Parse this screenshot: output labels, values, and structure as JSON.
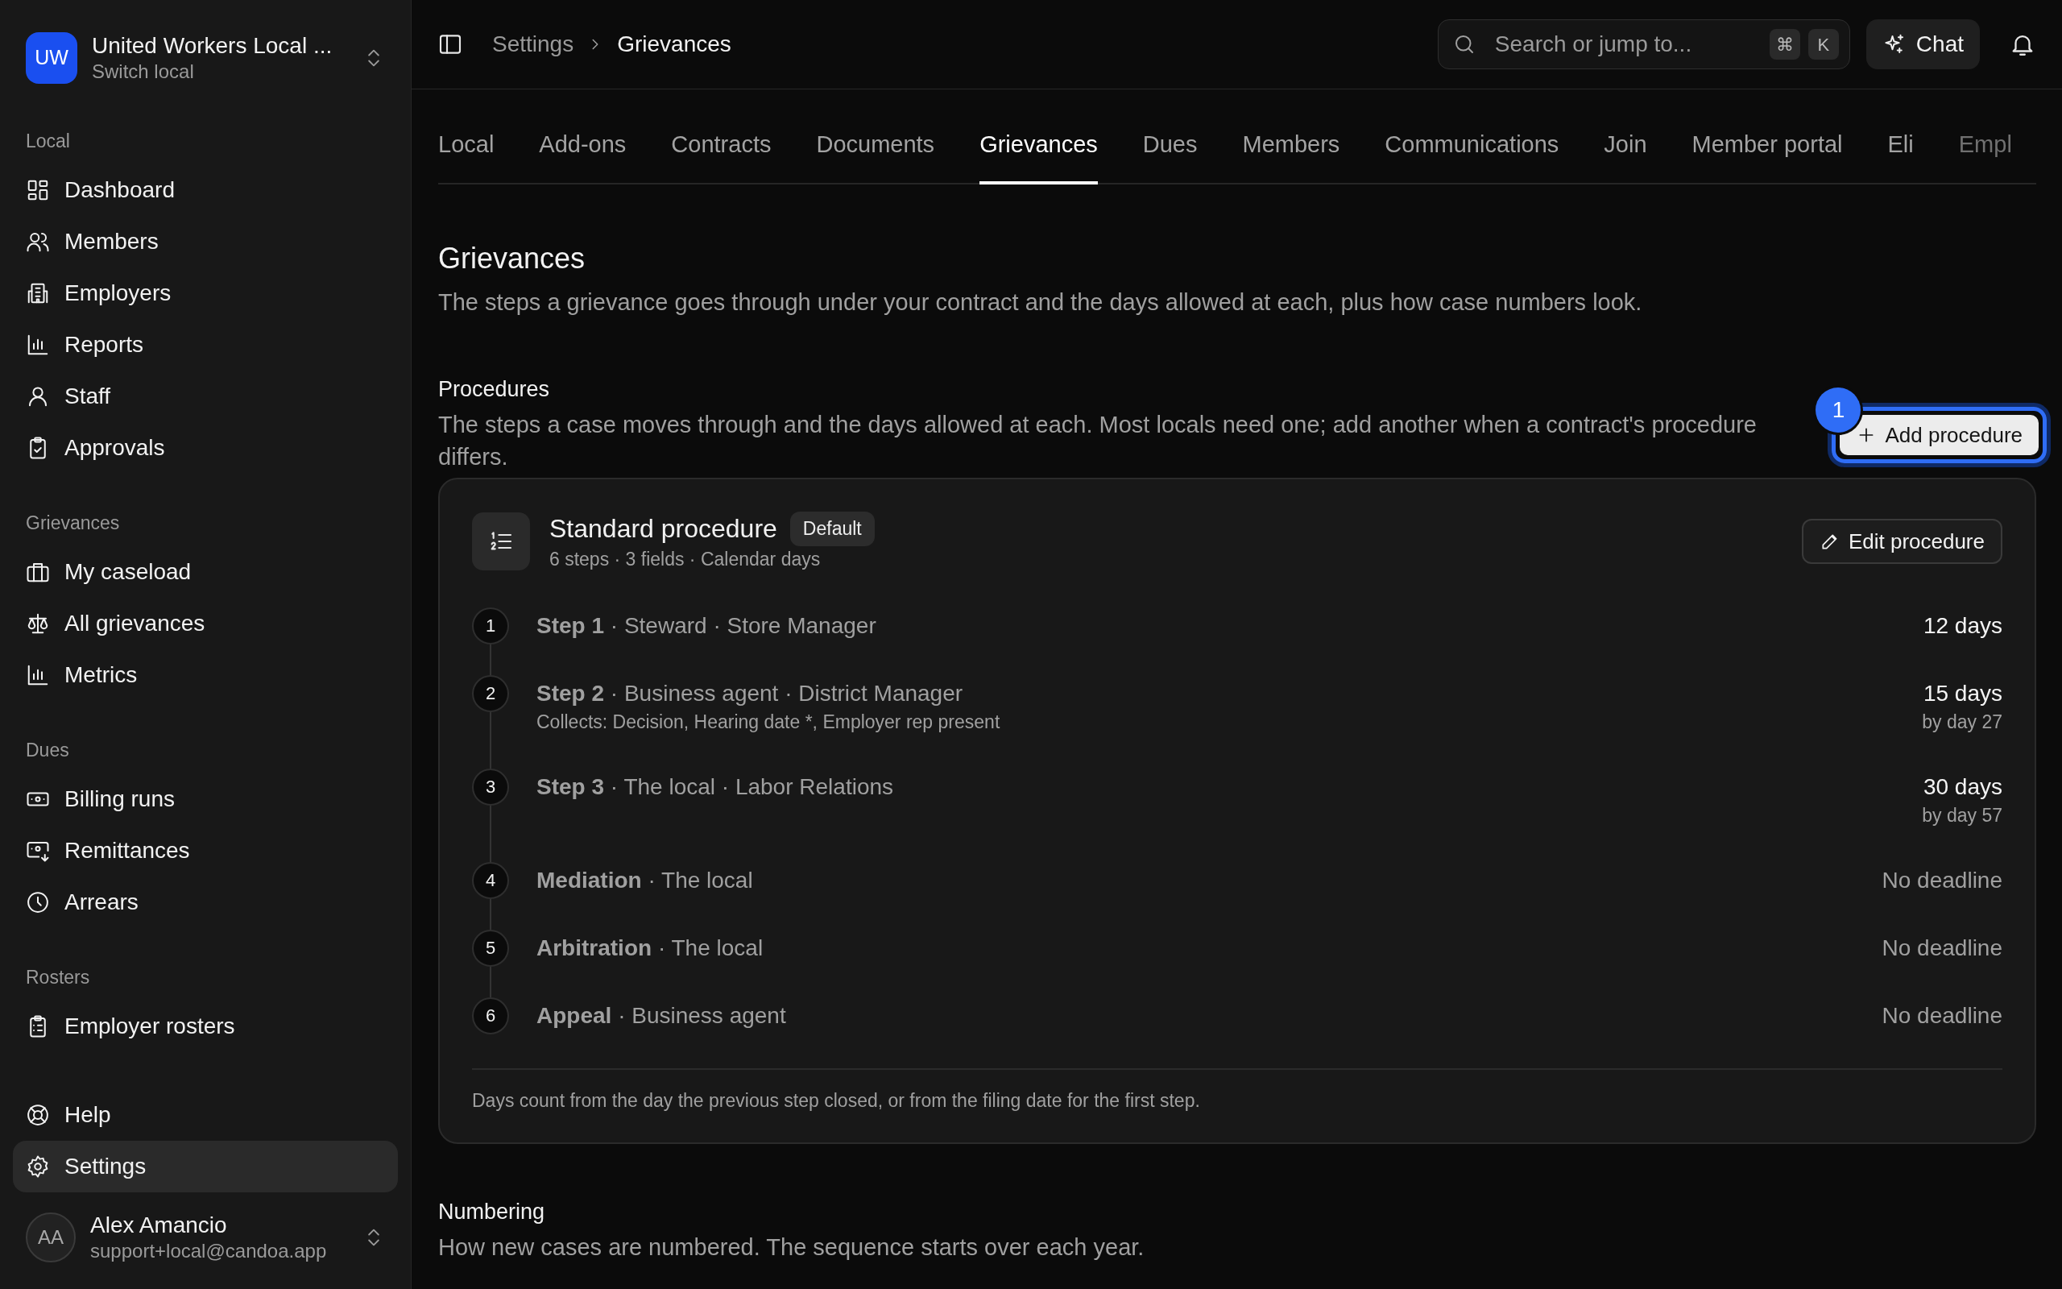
{
  "sidebar": {
    "org": {
      "initials": "UW",
      "name": "United Workers Local ...",
      "subtitle": "Switch local"
    },
    "sections": [
      {
        "label": "Local",
        "items": [
          {
            "label": "Dashboard",
            "selected": false
          },
          {
            "label": "Members",
            "selected": false
          },
          {
            "label": "Employers",
            "selected": false
          },
          {
            "label": "Reports",
            "selected": false
          },
          {
            "label": "Staff",
            "selected": false
          },
          {
            "label": "Approvals",
            "selected": false
          }
        ]
      },
      {
        "label": "Grievances",
        "items": [
          {
            "label": "My caseload",
            "selected": false
          },
          {
            "label": "All grievances",
            "selected": false
          },
          {
            "label": "Metrics",
            "selected": false
          }
        ]
      },
      {
        "label": "Dues",
        "items": [
          {
            "label": "Billing runs",
            "selected": false
          },
          {
            "label": "Remittances",
            "selected": false
          },
          {
            "label": "Arrears",
            "selected": false
          }
        ]
      },
      {
        "label": "Rosters",
        "items": [
          {
            "label": "Employer rosters",
            "selected": false
          }
        ]
      }
    ],
    "footer_items": [
      {
        "label": "Help",
        "selected": false
      },
      {
        "label": "Settings",
        "selected": true
      }
    ],
    "user": {
      "initials": "AA",
      "name": "Alex Amancio",
      "email": "support+local@candoa.app"
    }
  },
  "topbar": {
    "breadcrumb": [
      "Settings",
      "Grievances"
    ],
    "search": {
      "placeholder": "Search or jump to...",
      "shortcut": [
        "⌘",
        "K"
      ]
    },
    "chat_button": "Chat"
  },
  "tabs": [
    {
      "label": "Local",
      "selected": false
    },
    {
      "label": "Add-ons",
      "selected": false
    },
    {
      "label": "Contracts",
      "selected": false
    },
    {
      "label": "Documents",
      "selected": false
    },
    {
      "label": "Grievances",
      "selected": true
    },
    {
      "label": "Dues",
      "selected": false
    },
    {
      "label": "Members",
      "selected": false
    },
    {
      "label": "Communications",
      "selected": false
    },
    {
      "label": "Join",
      "selected": false
    },
    {
      "label": "Member portal",
      "selected": false
    },
    {
      "label": "Eli",
      "selected": false
    },
    {
      "label": "Empl",
      "selected": false
    }
  ],
  "page": {
    "title": "Grievances",
    "description": "The steps a grievance goes through under your contract and the days allowed at each, plus how case numbers look."
  },
  "procedures": {
    "title": "Procedures",
    "description": "The steps a case moves through and the days allowed at each. Most locals need one; add another when a contract's procedure differs.",
    "add_button": {
      "label": "Add procedure",
      "highlighted": true,
      "badge": "1"
    },
    "cards": [
      {
        "title": "Standard procedure",
        "badge": "Default",
        "meta": "6 steps · 3 fields · Calendar days",
        "edit_button": "Edit procedure",
        "steps": [
          {
            "number": "1",
            "text": "**Step 1** · Steward · Store Manager",
            "deadline": {
              "kind": "days",
              "text": "12 days"
            }
          },
          {
            "number": "2",
            "text": "**Step 2** · Business agent · District Manager",
            "collects": "Collects: Decision, Hearing date *, Employer rep present",
            "deadline": {
              "kind": "days",
              "text": "15 days",
              "sub": "by day 27"
            }
          },
          {
            "number": "3",
            "text": "**Step 3** · The local · Labor Relations",
            "deadline": {
              "kind": "days",
              "text": "30 days",
              "sub": "by day 57"
            }
          },
          {
            "number": "4",
            "text": "**Mediation** · The local",
            "deadline": {
              "kind": "none",
              "text": "No deadline"
            }
          },
          {
            "number": "5",
            "text": "**Arbitration** · The local",
            "deadline": {
              "kind": "none",
              "text": "No deadline"
            }
          },
          {
            "number": "6",
            "text": "**Appeal** · Business agent",
            "deadline": {
              "kind": "none",
              "text": "No deadline"
            }
          }
        ],
        "footnote": "Days count from the day the previous step closed, or from the filing date for the first step."
      }
    ]
  },
  "numbering": {
    "title": "Numbering",
    "description": "How new cases are numbered. The sequence starts over each year."
  }
}
